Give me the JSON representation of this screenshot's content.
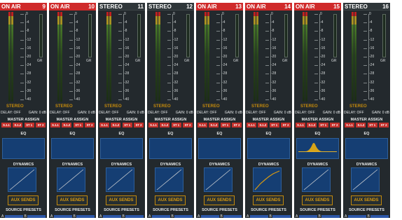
{
  "scale_labels": [
    "0",
    "-4",
    "-8",
    "-12",
    "-16",
    "-20",
    "-24",
    "-28",
    "-32",
    "-36",
    "-40"
  ],
  "gr_label": "GR",
  "stereo_label": "STEREO",
  "delay_label": "DELAY: OFF",
  "gain_label": "GAIN: 0 dB",
  "master_assign_label": "MASTER ASSIGN",
  "assign_buttons": [
    "S.1.1",
    "S.1.2",
    "ST 1",
    "ST 2"
  ],
  "eq_label": "EQ",
  "dynamics_label": "DYNAMICS",
  "aux_sends_label": "AUX SENDS",
  "source_presets_label": "SOURCE PRESETS",
  "preset_a_label": "A",
  "preset_b_label": "B",
  "colors": {
    "on_air_red": "#cf2a2a",
    "stripe_bg": "#23292d",
    "accent_orange": "#d99a10",
    "eq_blue": "#153e73",
    "assign_red": "#c4302b"
  },
  "channels": [
    {
      "status": "ON AIR",
      "number": "9",
      "on_air": true,
      "eq_curve": "flat",
      "dyn_curve": "linear"
    },
    {
      "status": "ON AIR",
      "number": "10",
      "on_air": true,
      "eq_curve": "flat",
      "dyn_curve": "linear"
    },
    {
      "status": "STEREO",
      "number": "11",
      "on_air": false,
      "eq_curve": "flat",
      "dyn_curve": "linear"
    },
    {
      "status": "STEREO",
      "number": "12",
      "on_air": false,
      "eq_curve": "flat",
      "dyn_curve": "linear"
    },
    {
      "status": "ON AIR",
      "number": "13",
      "on_air": true,
      "eq_curve": "flat",
      "dyn_curve": "linear"
    },
    {
      "status": "ON AIR",
      "number": "14",
      "on_air": true,
      "eq_curve": "flat",
      "dyn_curve": "compressed"
    },
    {
      "status": "ON AIR",
      "number": "15",
      "on_air": true,
      "eq_curve": "peak",
      "dyn_curve": "linear"
    },
    {
      "status": "STEREO",
      "number": "16",
      "on_air": false,
      "eq_curve": "flat",
      "dyn_curve": "linear"
    }
  ]
}
